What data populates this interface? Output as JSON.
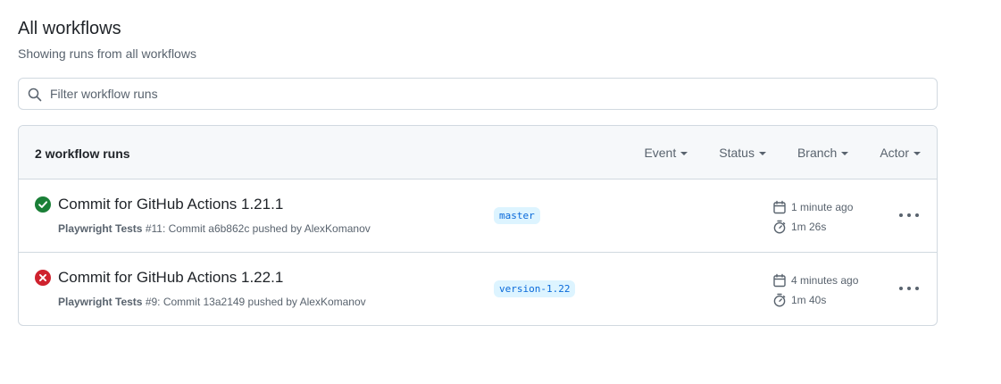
{
  "page": {
    "title": "All workflows",
    "subtitle": "Showing runs from all workflows"
  },
  "search": {
    "placeholder": "Filter workflow runs",
    "value": ""
  },
  "runs_header": {
    "count_label": "2 workflow runs",
    "filters": [
      "Event",
      "Status",
      "Branch",
      "Actor"
    ]
  },
  "runs": [
    {
      "status": "success",
      "title": "Commit for GitHub Actions 1.21.1",
      "workflow": "Playwright Tests",
      "detail": " #11: Commit a6b862c pushed by AlexKomanov",
      "branch": "master",
      "time_ago": "1 minute ago",
      "duration": "1m 26s"
    },
    {
      "status": "failure",
      "title": "Commit for GitHub Actions 1.22.1",
      "workflow": "Playwright Tests",
      "detail": " #9: Commit 13a2149 pushed by AlexKomanov",
      "branch": "version-1.22",
      "time_ago": "4 minutes ago",
      "duration": "1m 40s"
    }
  ],
  "colors": {
    "success": "#1a7f37",
    "failure": "#cf222e",
    "badge_text": "#0969da",
    "badge_bg": "#ddf4ff"
  },
  "icons": {
    "search": "search-icon",
    "success": "check-circle-fill-icon",
    "failure": "x-circle-fill-icon",
    "calendar": "calendar-icon",
    "stopwatch": "stopwatch-icon",
    "more": "kebab-horizontal-icon"
  }
}
